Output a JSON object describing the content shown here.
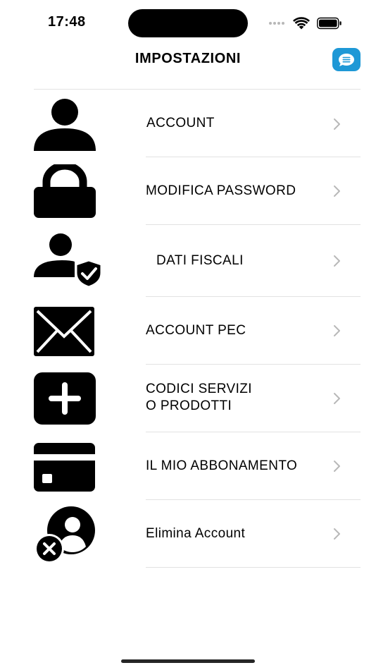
{
  "status_bar": {
    "time": "17:48"
  },
  "header": {
    "title": "IMPOSTAZIONI",
    "chat_button_color": "#1e98d6"
  },
  "menu": {
    "items": [
      {
        "label": "ACCOUNT",
        "icon": "user-icon"
      },
      {
        "label": "MODIFICA PASSWORD",
        "icon": "lock-icon"
      },
      {
        "label": "DATI FISCALI",
        "icon": "user-shield-icon"
      },
      {
        "label": "ACCOUNT PEC",
        "icon": "envelope-icon"
      },
      {
        "label": "CODICI SERVIZI\nO PRODOTTI",
        "icon": "plus-square-icon"
      },
      {
        "label": "IL MIO ABBONAMENTO",
        "icon": "credit-card-icon"
      },
      {
        "label": "Elimina Account",
        "icon": "user-delete-icon"
      }
    ]
  }
}
